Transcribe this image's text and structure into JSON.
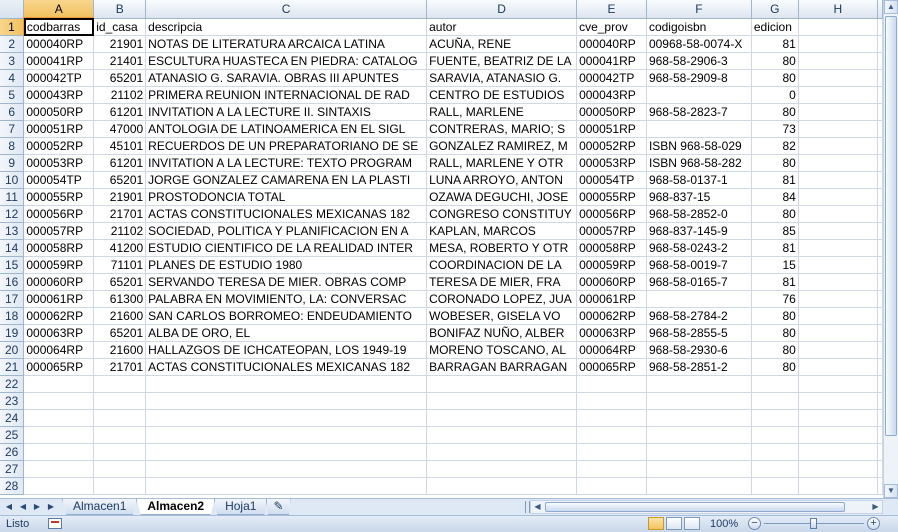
{
  "sheet": {
    "columns": [
      "A",
      "B",
      "C",
      "D",
      "E",
      "F",
      "G",
      "H"
    ],
    "active_column": "A",
    "active_row": "1",
    "headers": [
      "codbarras",
      "id_casa",
      "descripcia",
      "autor",
      "cve_prov",
      "codigoisbn",
      "edicion"
    ],
    "rows": [
      [
        "000040RP",
        "21901",
        "NOTAS DE LITERATURA ARCAICA LATINA",
        "ACUÑA, RENE",
        "000040RP",
        "00968-58-0074-X",
        "81"
      ],
      [
        "000041RP",
        "21401",
        "ESCULTURA HUASTECA EN PIEDRA: CATALOG",
        "FUENTE, BEATRIZ DE LA",
        "000041RP",
        "968-58-2906-3",
        "80"
      ],
      [
        "000042TP",
        "65201",
        "ATANASIO G. SARAVIA. OBRAS III APUNTES",
        "SARAVIA, ATANASIO G.",
        "000042TP",
        "968-58-2909-8",
        "80"
      ],
      [
        "000043RP",
        "21102",
        "PRIMERA REUNION INTERNACIONAL DE RAD",
        "CENTRO DE ESTUDIOS",
        "000043RP",
        "",
        "0"
      ],
      [
        "000050RP",
        "61201",
        "INVITATION A LA LECTURE II. SINTAXIS",
        "RALL, MARLENE",
        "000050RP",
        "968-58-2823-7",
        "80"
      ],
      [
        "000051RP",
        "47000",
        "ANTOLOGIA DE LATINOAMERICA EN EL SIGL",
        "CONTRERAS, MARIO; S",
        "000051RP",
        "",
        "73"
      ],
      [
        "000052RP",
        "45101",
        "RECUERDOS DE UN PREPARATORIANO DE SE",
        "GONZALEZ RAMIREZ, M",
        "000052RP",
        "ISBN 968-58-029",
        "82"
      ],
      [
        "000053RP",
        "61201",
        "INVITATION A LA LECTURE: TEXTO PROGRAM",
        "RALL, MARLENE Y OTR",
        "000053RP",
        "ISBN 968-58-282",
        "80"
      ],
      [
        "000054TP",
        "65201",
        "JORGE GONZALEZ CAMARENA EN LA PLASTI",
        "LUNA ARROYO, ANTON",
        "000054TP",
        "968-58-0137-1",
        "81"
      ],
      [
        "000055RP",
        "21901",
        "PROSTODONCIA TOTAL",
        "OZAWA DEGUCHI, JOSE",
        "000055RP",
        "968-837-15",
        "84"
      ],
      [
        "000056RP",
        "21701",
        "ACTAS CONSTITUCIONALES MEXICANAS 182",
        "CONGRESO CONSTITUY",
        "000056RP",
        "968-58-2852-0",
        "80"
      ],
      [
        "000057RP",
        "21102",
        "SOCIEDAD, POLITICA Y PLANIFICACION EN A",
        "KAPLAN, MARCOS",
        "000057RP",
        "968-837-145-9",
        "85"
      ],
      [
        "000058RP",
        "41200",
        "ESTUDIO CIENTIFICO DE LA REALIDAD INTER",
        "MESA, ROBERTO Y OTR",
        "000058RP",
        "968-58-0243-2",
        "81"
      ],
      [
        "000059RP",
        "71101",
        "PLANES DE ESTUDIO 1980",
        "COORDINACION DE LA",
        "000059RP",
        "968-58-0019-7",
        "15"
      ],
      [
        "000060RP",
        "65201",
        "SERVANDO TERESA DE MIER. OBRAS COMP",
        "TERESA DE MIER, FRA",
        "000060RP",
        "968-58-0165-7",
        "81"
      ],
      [
        "000061RP",
        "61300",
        "PALABRA EN MOVIMIENTO, LA: CONVERSAC",
        "CORONADO LOPEZ, JUA",
        "000061RP",
        "",
        "76"
      ],
      [
        "000062RP",
        "21600",
        "SAN CARLOS BORROMEO: ENDEUDAMIENTO",
        "WOBESER, GISELA VO",
        "000062RP",
        "968-58-2784-2",
        "80"
      ],
      [
        "000063RP",
        "65201",
        "ALBA DE ORO, EL",
        "BONIFAZ NUÑO, ALBER",
        "000063RP",
        "968-58-2855-5",
        "80"
      ],
      [
        "000064RP",
        "21600",
        "HALLAZGOS DE ICHCATEOPAN, LOS 1949-19",
        "MORENO TOSCANO, AL",
        "000064RP",
        "968-58-2930-6",
        "80"
      ],
      [
        "000065RP",
        "21701",
        "ACTAS CONSTITUCIONALES MEXICANAS 182",
        "BARRAGAN BARRAGAN",
        "000065RP",
        "968-58-2851-2",
        "80"
      ]
    ],
    "empty_row_numbers": [
      "22",
      "23",
      "24",
      "25",
      "26",
      "27",
      "28"
    ]
  },
  "tabs": [
    "Almacen1",
    "Almacen2",
    "Hoja1"
  ],
  "active_tab": "Almacen2",
  "status": {
    "text": "Listo",
    "zoom": "100%"
  }
}
